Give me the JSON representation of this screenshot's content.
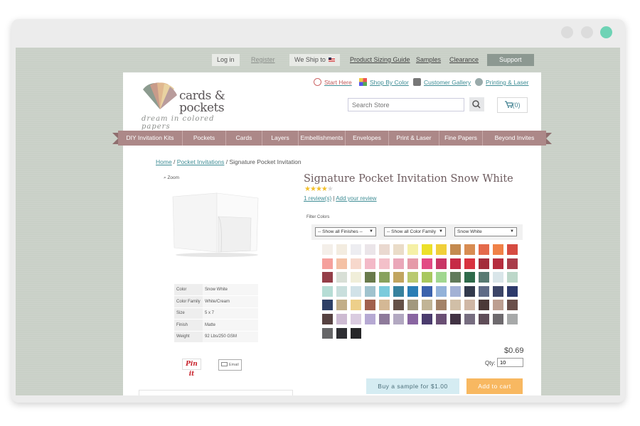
{
  "topbar": {
    "login": "Log in",
    "register": "Register",
    "ship_to": "We Ship to",
    "links": [
      "Product Sizing Guide",
      "Samples",
      "Clearance"
    ],
    "support": "Support"
  },
  "logo": {
    "line1": "cards &",
    "line2": "pockets",
    "tagline": "dream in colored papers"
  },
  "quick_links": [
    "Start Here",
    "Shop By Color",
    "Customer Gallery",
    "Printing & Laser"
  ],
  "search": {
    "placeholder": "Search Store"
  },
  "cart": {
    "label": "(0)"
  },
  "nav": [
    "DIY Invitation Kits",
    "Pockets",
    "Cards",
    "Layers",
    "Embellishments",
    "Envelopes",
    "Print & Laser",
    "Fine Papers",
    "Beyond Invites"
  ],
  "breadcrumb": {
    "home": "Home",
    "category": "Pocket Invitations",
    "current": "Signature Pocket Invitation"
  },
  "zoom_label": "Zoom",
  "specs": [
    {
      "key": "Color",
      "value": "Snow White"
    },
    {
      "key": "Color Family",
      "value": "White/Cream"
    },
    {
      "key": "Size",
      "value": "5 x 7"
    },
    {
      "key": "Finish",
      "value": "Matte"
    },
    {
      "key": "Weight",
      "value": "92 Lbs/250 GSM"
    }
  ],
  "share": {
    "pinit": "Pin it",
    "email": "Email"
  },
  "product": {
    "title": "Signature Pocket Invitation Snow White",
    "rating": 4,
    "rating_max": 5,
    "reviews_link": "1 review(s)",
    "add_review": "Add your review"
  },
  "filters": {
    "label": "Filter Colors",
    "finishes": "-- Show all Finishes --",
    "family": "-- Show all Color Family",
    "color": "Snow White"
  },
  "swatch_colors": [
    "#f4efe9",
    "#f3ece0",
    "#ededf1",
    "#ebe5e9",
    "#ead9d0",
    "#eadcc8",
    "#f5f0a6",
    "#ece02a",
    "#f0cf3a",
    "#c48a4f",
    "#d88c52",
    "#e46a4b",
    "#f08147",
    "#d64b41",
    "#f5a09c",
    "#f4c1a5",
    "#f7d8cc",
    "#f3b9c7",
    "#f3c0c9",
    "#eaa7b9",
    "#e59ba9",
    "#e24b84",
    "#c83665",
    "#c62a45",
    "#d8323f",
    "#a32d3b",
    "#b62e3f",
    "#a93c4a",
    "#943e48",
    "#d8dfd6",
    "#f0eed9",
    "#697a4b",
    "#88a25e",
    "#c1a55f",
    "#b9c96f",
    "#a8c85e",
    "#a1d790",
    "#607a5a",
    "#2e6a4a",
    "#587a72",
    "#d9e5e9",
    "#bcd7c9",
    "#b6ddd5",
    "#c9dfdd",
    "#d1e2e8",
    "#a0c3ce",
    "#7bcbdc",
    "#38829e",
    "#2b7eb5",
    "#3c63ad",
    "#93b2d9",
    "#a2b1d5",
    "#323a4d",
    "#5f6b86",
    "#3c4567",
    "#2d3a6b",
    "#2e4066",
    "#c2ae89",
    "#edcf8a",
    "#a1604d",
    "#d4b895",
    "#655148",
    "#a2987e",
    "#c1b496",
    "#a38268",
    "#d1bfa7",
    "#cfb7a5",
    "#4b3a38",
    "#bd9f91",
    "#6a4f4a",
    "#564241",
    "#cdbbd2",
    "#dacce0",
    "#b6a9d3",
    "#8e7a9a",
    "#b2a8c1",
    "#8965a1",
    "#4b3c6e",
    "#6a4f74",
    "#423344",
    "#776d80",
    "#5f4d58",
    "#6e6a6e",
    "#a7a9a9",
    "#666668",
    "#2f2f33",
    "#262628"
  ],
  "price": "$0.69",
  "qty": {
    "label": "Qty:",
    "value": "10"
  },
  "buttons": {
    "sample": "Buy a sample for $1.00",
    "add_to_cart": "Add to cart"
  }
}
